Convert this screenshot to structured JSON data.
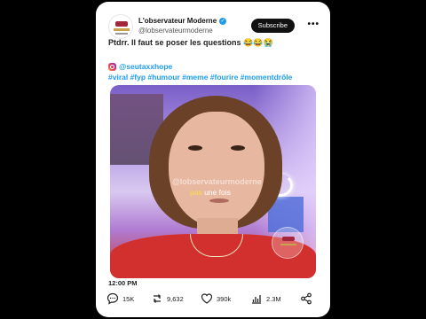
{
  "post": {
    "account_name": "L'observateur Moderne",
    "handle": "@lobservateurmoderne",
    "subscribe_label": "Subscribe",
    "more_label": "•••",
    "text": "Ptdrr. Il faut se poser les questions 😂😂😭",
    "mention": "@seutaxxhope",
    "hashtags": "#viral #fyp #humour #meme #fourire #momentdrôle",
    "time": "12:00 PM"
  },
  "video": {
    "watermark": "@lobservateurmoderne",
    "caption_highlight": "pas",
    "caption_rest": " une fois"
  },
  "actions": {
    "comments": "15K",
    "reposts": "9,632",
    "likes": "390k",
    "views": "2.3M"
  },
  "colors": {
    "link": "#1d9bf0",
    "verified": "#1d9bf0",
    "button": "#111111"
  }
}
